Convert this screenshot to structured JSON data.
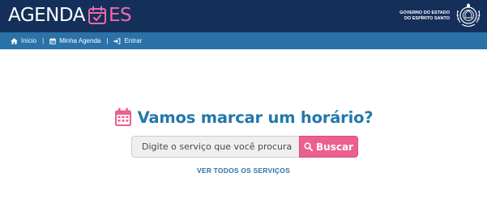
{
  "header": {
    "logo_left": "AGENDA",
    "logo_right": "ES",
    "gov_line1": "GOVERNO DO ESTADO",
    "gov_line2": "DO ESPÍRITO SANTO",
    "colors": {
      "background": "#14305a",
      "accent": "#f06aa7"
    }
  },
  "nav": {
    "items": [
      {
        "label": "Início",
        "icon": "home-icon"
      },
      {
        "label": "Minha Agenda",
        "icon": "calendar-icon"
      },
      {
        "label": "Entrar",
        "icon": "sign-in-icon"
      }
    ],
    "separator": "|",
    "colors": {
      "background": "#2a72a8"
    }
  },
  "main": {
    "title": "Vamos marcar um horário?",
    "title_icon": "calendar-icon",
    "search": {
      "placeholder": "Digite o serviço que você procura",
      "value": "",
      "button_label": "Buscar",
      "button_icon": "search-icon"
    },
    "all_services_link": "VER TODOS OS SERVIÇOS",
    "colors": {
      "title": "#2378aa",
      "button": "#ec5f91",
      "icon": "#ec5f91"
    }
  }
}
